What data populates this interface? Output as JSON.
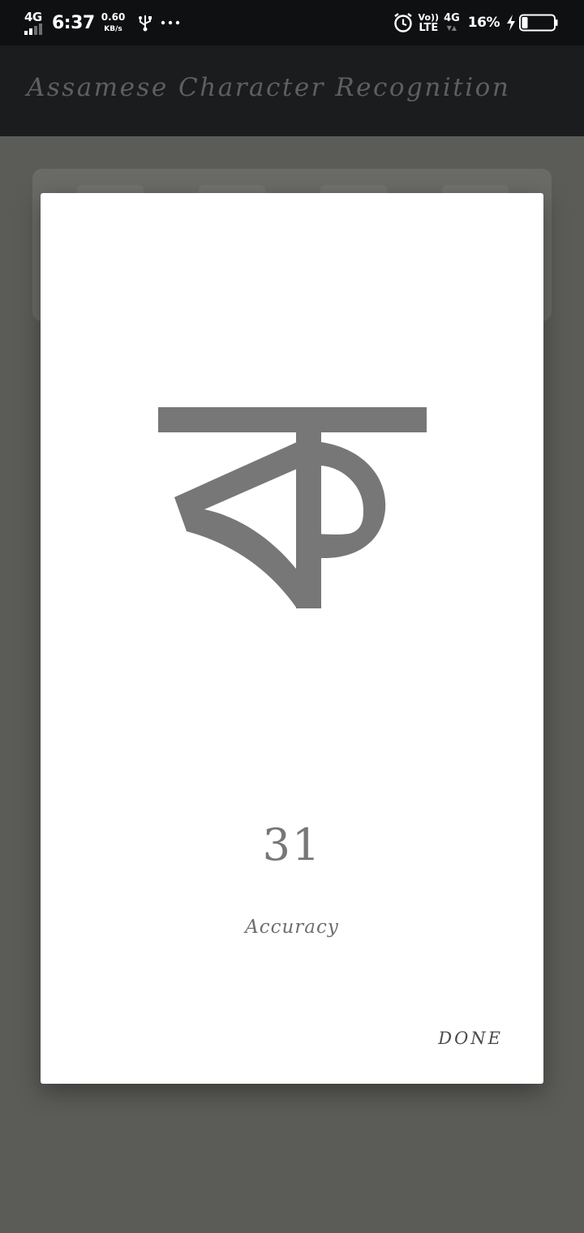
{
  "status_bar": {
    "network": "4G",
    "time": "6:37",
    "speed_value": "0.60",
    "speed_unit": "KB/s",
    "volte_top": "Vo))",
    "volte_bottom": "LTE",
    "network2": "4G",
    "battery_percent": "16%",
    "battery_level": 0.16,
    "icons": [
      "signal-icon",
      "usb-icon",
      "more-dots-icon",
      "alarm-icon",
      "charging-bolt-icon",
      "battery-icon"
    ]
  },
  "app_bar": {
    "title": "Assamese Character Recognition"
  },
  "dialog": {
    "character": "ক",
    "score": "31",
    "caption": "Accuracy",
    "done_label": "DONE"
  },
  "colors": {
    "status_bar_bg": "#0f1012",
    "app_bar_bg": "#1b1c1e",
    "scrim": "#5b5c58",
    "dialog_bg": "#ffffff",
    "character_color": "#777777"
  }
}
